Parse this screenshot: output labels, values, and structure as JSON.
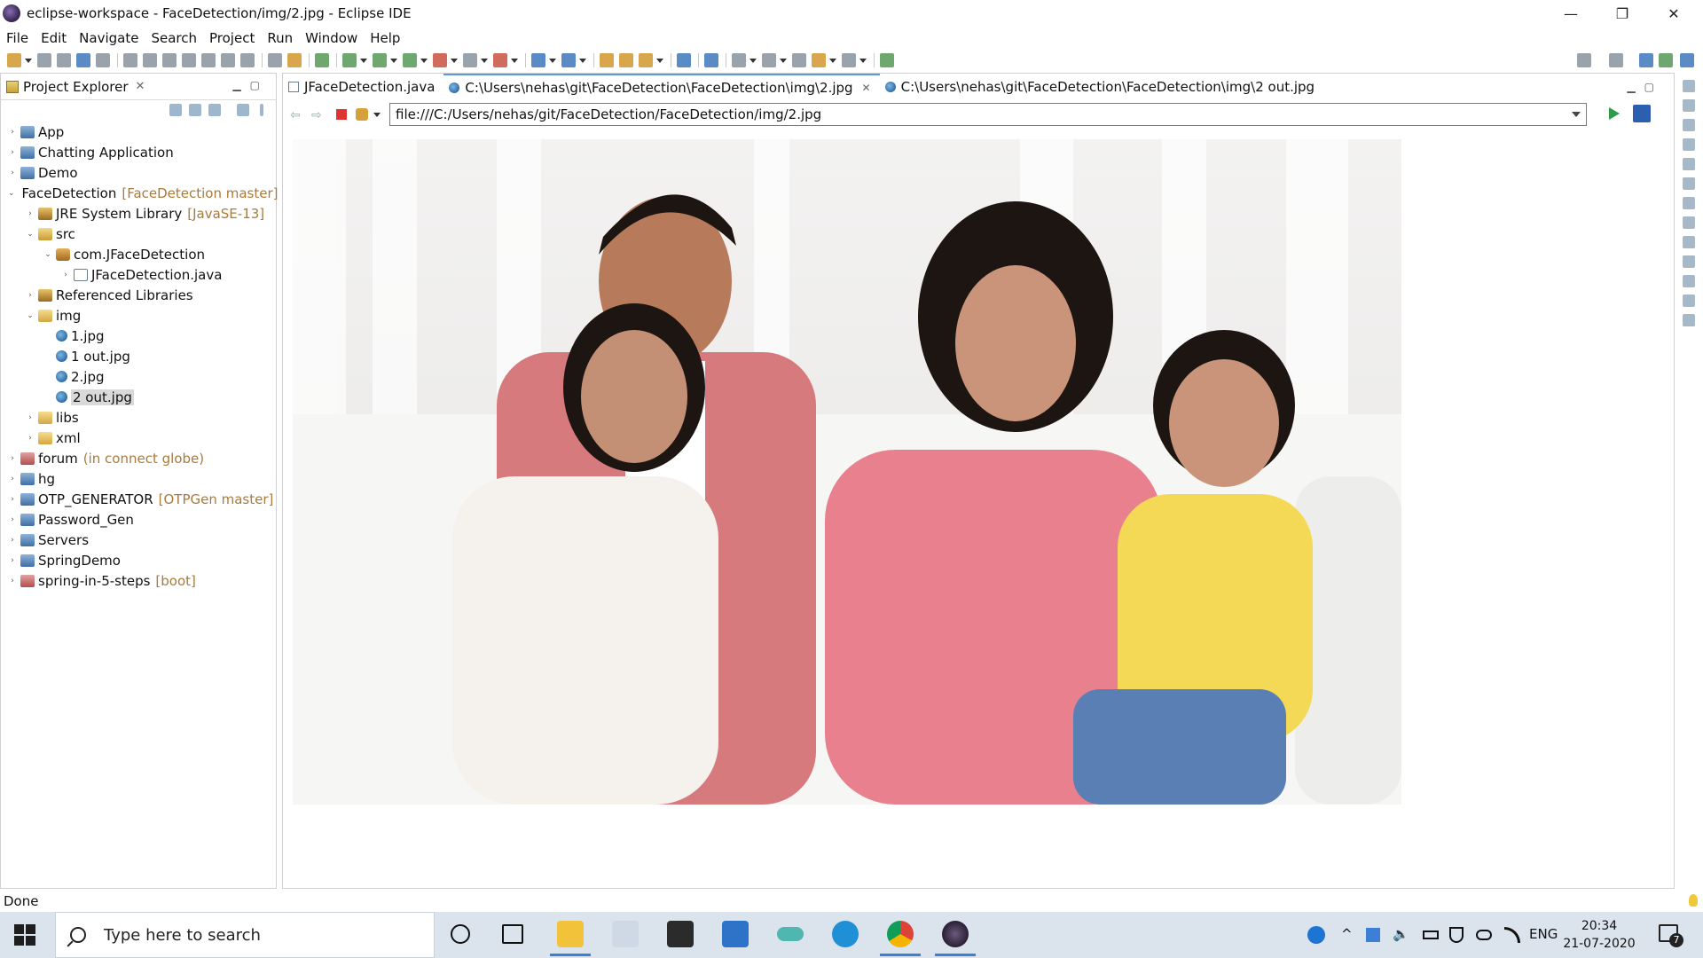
{
  "window": {
    "title": "eclipse-workspace - FaceDetection/img/2.jpg - Eclipse IDE",
    "minimize": "—",
    "restore": "❐",
    "close": "✕"
  },
  "menu": [
    "File",
    "Edit",
    "Navigate",
    "Search",
    "Project",
    "Run",
    "Window",
    "Help"
  ],
  "explorer": {
    "title": "Project Explorer",
    "close": "✕",
    "tree": [
      {
        "label": "App",
        "indent": 0,
        "twisty": "›",
        "icon": "proj",
        "deco": ""
      },
      {
        "label": "Chatting Application",
        "indent": 0,
        "twisty": "›",
        "icon": "proj",
        "deco": ""
      },
      {
        "label": "Demo",
        "indent": 0,
        "twisty": "›",
        "icon": "proj",
        "deco": ""
      },
      {
        "label": "FaceDetection",
        "indent": 0,
        "twisty": "⌄",
        "icon": "proj",
        "deco": "[FaceDetection master]"
      },
      {
        "label": "JRE System Library",
        "indent": 1,
        "twisty": "›",
        "icon": "lib",
        "deco": "[JavaSE-13]"
      },
      {
        "label": "src",
        "indent": 1,
        "twisty": "⌄",
        "icon": "pkgroot",
        "deco": ""
      },
      {
        "label": "com.JFaceDetection",
        "indent": 2,
        "twisty": "⌄",
        "icon": "pkg",
        "deco": ""
      },
      {
        "label": "JFaceDetection.java",
        "indent": 3,
        "twisty": "›",
        "icon": "java",
        "deco": ""
      },
      {
        "label": "Referenced Libraries",
        "indent": 1,
        "twisty": "›",
        "icon": "lib",
        "deco": ""
      },
      {
        "label": "img",
        "indent": 1,
        "twisty": "⌄",
        "icon": "folder",
        "deco": ""
      },
      {
        "label": "1.jpg",
        "indent": 2,
        "twisty": "",
        "icon": "img",
        "deco": ""
      },
      {
        "label": "1 out.jpg",
        "indent": 2,
        "twisty": "",
        "icon": "img",
        "deco": ""
      },
      {
        "label": "2.jpg",
        "indent": 2,
        "twisty": "",
        "icon": "img",
        "deco": ""
      },
      {
        "label": "2 out.jpg",
        "indent": 2,
        "twisty": "",
        "icon": "img",
        "deco": "",
        "selected": true
      },
      {
        "label": "libs",
        "indent": 1,
        "twisty": "›",
        "icon": "folder",
        "deco": ""
      },
      {
        "label": "xml",
        "indent": 1,
        "twisty": "›",
        "icon": "folder",
        "deco": ""
      },
      {
        "label": "forum",
        "indent": 0,
        "twisty": "›",
        "icon": "projred",
        "deco": "(in connect globe)"
      },
      {
        "label": "hg",
        "indent": 0,
        "twisty": "›",
        "icon": "proj",
        "deco": ""
      },
      {
        "label": "OTP_GENERATOR",
        "indent": 0,
        "twisty": "›",
        "icon": "proj",
        "deco": "[OTPGen master]"
      },
      {
        "label": "Password_Gen",
        "indent": 0,
        "twisty": "›",
        "icon": "proj",
        "deco": ""
      },
      {
        "label": "Servers",
        "indent": 0,
        "twisty": "›",
        "icon": "proj",
        "deco": ""
      },
      {
        "label": "SpringDemo",
        "indent": 0,
        "twisty": "›",
        "icon": "proj",
        "deco": ""
      },
      {
        "label": "spring-in-5-steps",
        "indent": 0,
        "twisty": "›",
        "icon": "projred",
        "deco": "[boot]"
      }
    ]
  },
  "editor": {
    "tabs": [
      {
        "label": "JFaceDetection.java",
        "icon": "java",
        "active": false,
        "closable": false
      },
      {
        "label": "C:\\Users\\nehas\\git\\FaceDetection\\FaceDetection\\img\\2.jpg",
        "icon": "img",
        "active": true,
        "closable": true
      },
      {
        "label": "C:\\Users\\nehas\\git\\FaceDetection\\FaceDetection\\img\\2 out.jpg",
        "icon": "img",
        "active": false,
        "closable": false
      }
    ],
    "tab_close": "✕",
    "url": "file:///C:/Users/nehas/git/FaceDetection/FaceDetection/img/2.jpg"
  },
  "status": {
    "text": "Done"
  },
  "taskbar": {
    "search_placeholder": "Type here to search",
    "language": "ENG",
    "time": "20:34",
    "date": "21-07-2020",
    "notifications": "7"
  }
}
